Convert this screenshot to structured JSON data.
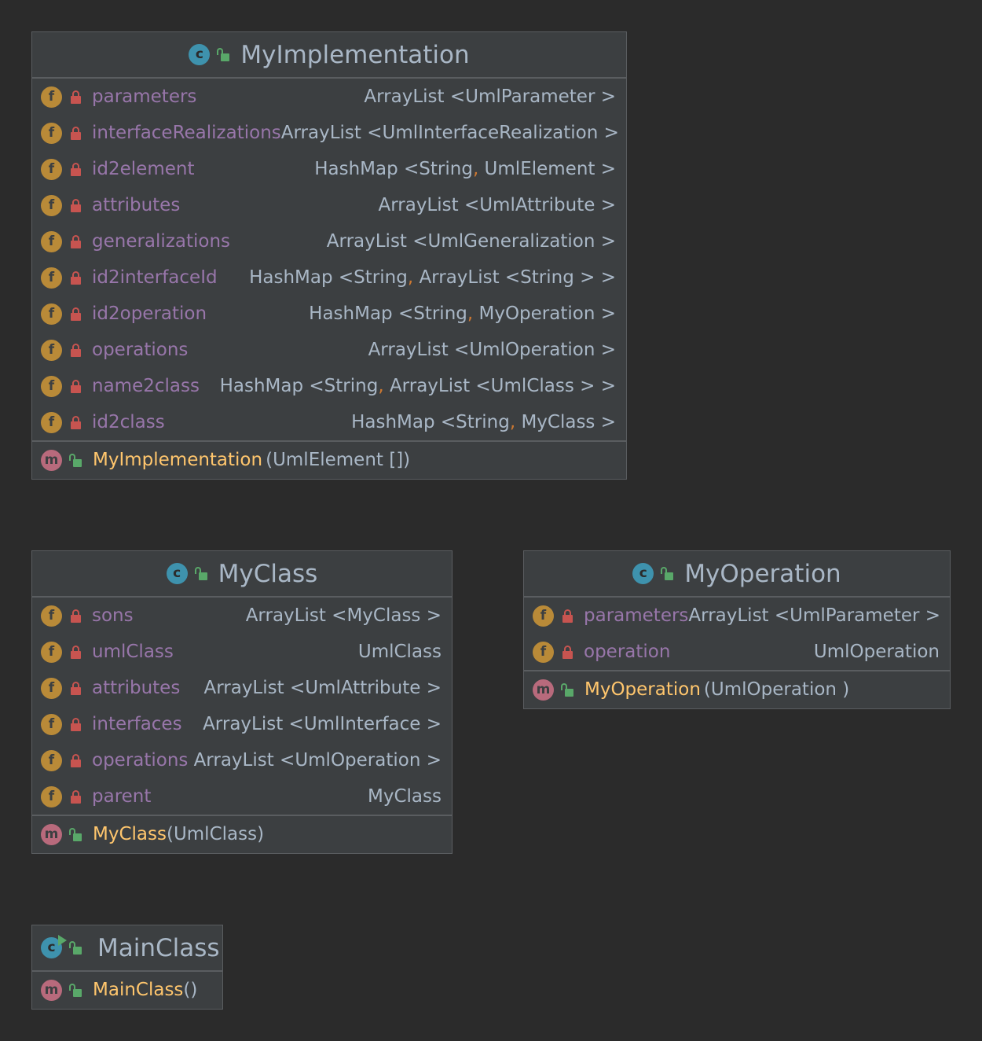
{
  "colors": {
    "background": "#2b2b2b",
    "box_fill": "#3c3f41",
    "border": "#5a5d60",
    "field_name": "#9876aa",
    "method_name": "#ffc66d",
    "type_text": "#a9b7c6",
    "comma": "#cc7832",
    "field_badge": "#b98a38",
    "method_badge": "#b86a7c",
    "class_badge": "#3e92ad",
    "private_lock": "#c75450",
    "public_lock": "#59a869"
  },
  "icons": {
    "class": "c",
    "field": "f",
    "method": "m"
  },
  "classes": [
    {
      "name": "MyImplementation",
      "fields": [
        {
          "name": "parameters",
          "type": "ArrayList <UmlParameter >"
        },
        {
          "name": "interfaceRealizations",
          "type": "ArrayList <UmlInterfaceRealization >"
        },
        {
          "name": "id2element",
          "type_a": "HashMap <String",
          "type_b": " UmlElement >"
        },
        {
          "name": "attributes",
          "type": "ArrayList <UmlAttribute >"
        },
        {
          "name": "generalizations",
          "type": "ArrayList <UmlGeneralization >"
        },
        {
          "name": "id2interfaceId",
          "type_a": "HashMap <String",
          "type_b": " ArrayList <String > >"
        },
        {
          "name": "id2operation",
          "type_a": "HashMap <String",
          "type_b": " MyOperation >"
        },
        {
          "name": "operations",
          "type": "ArrayList <UmlOperation >"
        },
        {
          "name": "name2class",
          "type_a": "HashMap <String",
          "type_b": " ArrayList <UmlClass > >"
        },
        {
          "name": "id2class",
          "type_a": "HashMap <String",
          "type_b": " MyClass >"
        }
      ],
      "methods": [
        {
          "name": "MyImplementation",
          "args": "(UmlElement [])"
        }
      ]
    },
    {
      "name": "MyClass",
      "fields": [
        {
          "name": "sons",
          "type": "ArrayList <MyClass >"
        },
        {
          "name": "umlClass",
          "type": "UmlClass"
        },
        {
          "name": "attributes",
          "type": "ArrayList <UmlAttribute >"
        },
        {
          "name": "interfaces",
          "type": "ArrayList <UmlInterface >"
        },
        {
          "name": "operations",
          "type": "ArrayList <UmlOperation >"
        },
        {
          "name": "parent",
          "type": "MyClass"
        }
      ],
      "methods": [
        {
          "name": "MyClass",
          "args": "(UmlClass)"
        }
      ]
    },
    {
      "name": "MyOperation",
      "fields": [
        {
          "name": "parameters",
          "type": "ArrayList <UmlParameter >"
        },
        {
          "name": "operation",
          "type": "UmlOperation"
        }
      ],
      "methods": [
        {
          "name": "MyOperation",
          "args": "(UmlOperation )"
        }
      ]
    },
    {
      "name": "MainClass",
      "fields": [],
      "methods": [
        {
          "name": "MainClass",
          "args": "()"
        }
      ]
    }
  ]
}
